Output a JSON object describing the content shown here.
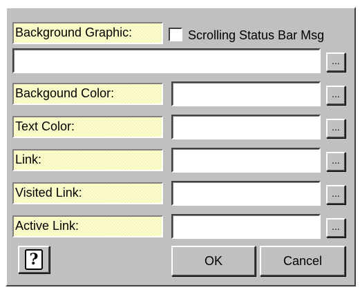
{
  "labels": {
    "background_graphic": "Background Graphic:",
    "background_color": "Backgound Color:",
    "text_color": "Text Color:",
    "link": "Link:",
    "visited_link": "Visited Link:",
    "active_link": "Active Link:"
  },
  "checkbox": {
    "label": "Scrolling Status Bar Msg",
    "checked": false
  },
  "browse_label": "...",
  "fields": {
    "background_graphic": "",
    "background_color": "",
    "text_color": "",
    "link": "",
    "visited_link": "",
    "active_link": ""
  },
  "buttons": {
    "ok": "OK",
    "cancel": "Cancel",
    "help_icon": "question-mark-icon"
  },
  "colors": {
    "dialog_bg": "#c0c0c0",
    "label_bg": "#ffffcc"
  }
}
